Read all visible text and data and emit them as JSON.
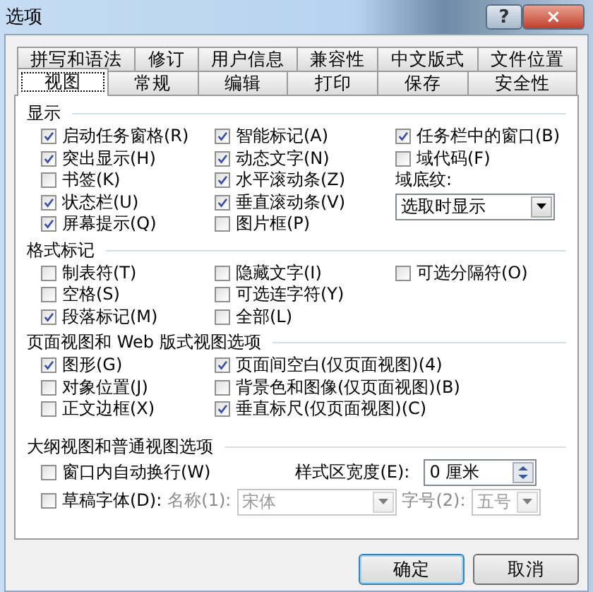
{
  "window": {
    "title": "选项",
    "help": "?",
    "close": "×"
  },
  "tabs_back": [
    {
      "label": "拼写和语法",
      "selected": false
    },
    {
      "label": "修订",
      "selected": false
    },
    {
      "label": "用户信息",
      "selected": false
    },
    {
      "label": "兼容性",
      "selected": false
    },
    {
      "label": "中文版式",
      "selected": false
    },
    {
      "label": "文件位置",
      "selected": false
    }
  ],
  "tabs_front": [
    {
      "label": "视图",
      "selected": true
    },
    {
      "label": "常规",
      "selected": false
    },
    {
      "label": "编辑",
      "selected": false
    },
    {
      "label": "打印",
      "selected": false
    },
    {
      "label": "保存",
      "selected": false
    },
    {
      "label": "安全性",
      "selected": false
    }
  ],
  "sections": [
    {
      "title": "显示",
      "columns": [
        [
          {
            "kind": "checkbox",
            "label": "启动任务窗格(R)",
            "checked": true
          },
          {
            "kind": "checkbox",
            "label": "突出显示(H)",
            "checked": true
          },
          {
            "kind": "checkbox",
            "label": "书签(K)",
            "checked": false
          },
          {
            "kind": "checkbox",
            "label": "状态栏(U)",
            "checked": true
          },
          {
            "kind": "checkbox",
            "label": "屏幕提示(Q)",
            "checked": true
          }
        ],
        [
          {
            "kind": "checkbox",
            "label": "智能标记(A)",
            "checked": true
          },
          {
            "kind": "checkbox",
            "label": "动态文字(N)",
            "checked": true
          },
          {
            "kind": "checkbox",
            "label": "水平滚动条(Z)",
            "checked": true
          },
          {
            "kind": "checkbox",
            "label": "垂直滚动条(V)",
            "checked": true
          },
          {
            "kind": "checkbox",
            "label": "图片框(P)",
            "checked": false
          }
        ],
        [
          {
            "kind": "checkbox",
            "label": "任务栏中的窗口(B)",
            "checked": true
          },
          {
            "kind": "checkbox",
            "label": "域代码(F)",
            "checked": false
          },
          {
            "kind": "label",
            "label": "域底纹:"
          },
          {
            "kind": "select",
            "value": "选取时显示"
          }
        ]
      ]
    },
    {
      "title": "格式标记",
      "columns": [
        [
          {
            "kind": "checkbox",
            "label": "制表符(T)",
            "checked": false
          },
          {
            "kind": "checkbox",
            "label": "空格(S)",
            "checked": false
          },
          {
            "kind": "checkbox",
            "label": "段落标记(M)",
            "checked": true
          }
        ],
        [
          {
            "kind": "checkbox",
            "label": "隐藏文字(I)",
            "checked": false
          },
          {
            "kind": "checkbox",
            "label": "可选连字符(Y)",
            "checked": false
          },
          {
            "kind": "checkbox",
            "label": "全部(L)",
            "checked": false
          }
        ],
        [
          {
            "kind": "checkbox",
            "label": "可选分隔符(O)",
            "checked": false
          }
        ]
      ]
    },
    {
      "title": "页面视图和 Web 版式视图选项",
      "columns": [
        [
          {
            "kind": "checkbox",
            "label": "图形(G)",
            "checked": true
          },
          {
            "kind": "checkbox",
            "label": "对象位置(J)",
            "checked": false
          },
          {
            "kind": "checkbox",
            "label": "正文边框(X)",
            "checked": false
          }
        ],
        [
          {
            "kind": "checkbox",
            "label": "页面间空白(仅页面视图)(4)",
            "checked": true
          },
          {
            "kind": "checkbox",
            "label": "背景色和图像(仅页面视图)(B)",
            "checked": false
          },
          {
            "kind": "checkbox",
            "label": "垂直标尺(仅页面视图)(C)",
            "checked": true
          }
        ]
      ]
    }
  ],
  "outline": {
    "title": "大纲视图和普通视图选项",
    "wrap": {
      "label": "窗口内自动换行(W)",
      "checked": false
    },
    "style_area": {
      "label": "样式区宽度(E):",
      "value": "0 厘米"
    },
    "draft_font": {
      "label": "草稿字体(D):",
      "checked": false
    },
    "font_name": {
      "label": "名称(1):",
      "value": "宋体",
      "disabled": true
    },
    "font_size": {
      "label": "字号(2):",
      "value": "五号",
      "disabled": true
    }
  },
  "buttons": [
    {
      "label": "确定",
      "default": true
    },
    {
      "label": "取消",
      "default": false
    }
  ]
}
